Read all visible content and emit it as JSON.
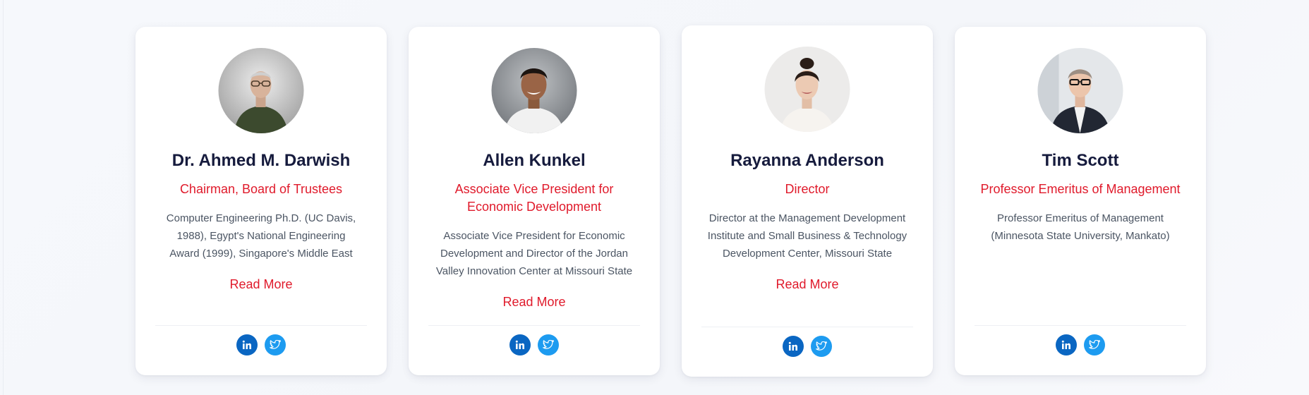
{
  "cards": [
    {
      "name": "Dr. Ahmed M. Darwish",
      "role": "Chairman, Board of Trustees",
      "bio": "Computer Engineering Ph.D. (UC Davis, 1988), Egypt's National Engineering Award (1999), Singapore's Middle East Eminent ...",
      "read_more": "Read More",
      "social": [
        "linkedin-icon",
        "twitter-icon"
      ]
    },
    {
      "name": "Allen Kunkel",
      "role": "Associate Vice President for Economic Development",
      "bio": "Associate Vice President for Economic Development and Director of the Jordan Valley Innovation Center at Missouri State ...",
      "read_more": "Read More",
      "social": [
        "linkedin-icon",
        "twitter-icon"
      ]
    },
    {
      "name": "Rayanna Anderson",
      "role": "Director",
      "bio": "Director at the Management Development Institute and Small Business & Technology Development Center, Missouri State Univ...",
      "read_more": "Read More",
      "social": [
        "linkedin-icon",
        "twitter-icon"
      ]
    },
    {
      "name": "Tim Scott",
      "role": "Professor Emeritus of Management",
      "bio": "Professor Emeritus of Management (Minnesota State University, Mankato)",
      "social": [
        "linkedin-icon",
        "twitter-icon"
      ]
    }
  ],
  "colors": {
    "name": "#161b3d",
    "accent": "#e01a2b",
    "linkedin": "#0a66c2",
    "twitter": "#1d9bf0"
  }
}
